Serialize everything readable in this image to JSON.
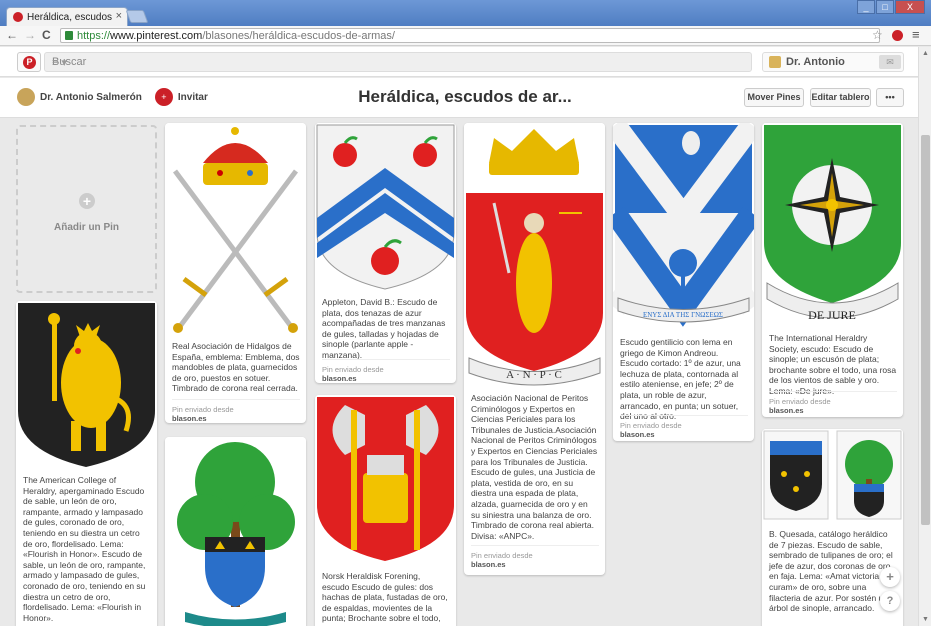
{
  "browser": {
    "tab_title": "Heráldica, escudos de",
    "tab_close": "×",
    "url_scheme": "https://",
    "url_domain": "www.pinterest.com",
    "url_path": "/blasones/heráldica-escudos-de-armas/",
    "back": "←",
    "forward": "→",
    "reload": "C",
    "star": "☆",
    "menu": "≡",
    "window_minimize": "_",
    "window_maximize": "□",
    "window_close": "X"
  },
  "pinterest_bar": {
    "logo": "P",
    "search_placeholder": "Buscar",
    "search_menu": "≡ ▾",
    "user_name": "Dr. Antonio",
    "messages": "✉"
  },
  "board_header": {
    "owner": "Dr. Antonio Salmerón",
    "invite_icon": "+",
    "invite": "Invitar",
    "title": "Heráldica, escudos de ar...",
    "move_pins": "Mover Pines",
    "edit_board": "Editar tablero",
    "more": "•••"
  },
  "add_pin": {
    "plus": "+",
    "label": "Añadir un Pin"
  },
  "pins": [
    {
      "desc": "The American College of Heraldry, apergaminado Escudo de sable, un león de oro, rampante, armado y lampasado de gules, coronado de oro, teniendo en su diestra un cetro de oro, flordelisado. Lema: «Flourish in Honor». Escudo de sable, un león de oro, rampante, armado y lampasado de gules, coronado de oro, teniendo en su diestra un cetro de oro, flordelisado. Lema: «Flourish in Honor»."
    },
    {
      "desc": "Real Asociación de Hidalgos de España, emblema: Emblema, dos mandobles de plata, guarnecidos de oro, puestos en sotuer. Timbrado de corona real cerrada.",
      "via": "Pin enviado desde",
      "source": "blason.es"
    },
    {
      "desc": "Appleton, David B.: Escudo de plata, dos tenazas de azur acompañadas de tres manzanas de gules, talladas y hojadas de sinople (parlante apple - manzana).",
      "via": "Pin enviado desde",
      "source": "blason.es"
    },
    {
      "desc": "Norsk Heraldisk Forening, escudo Escudo de gules: dos hachas de plata, fustadas de oro, de espaldas, movientes de la punta; Brochante sobre el todo, en el"
    },
    {
      "desc": "Asociación Nacional de Peritos Criminólogos y Expertos en Ciencias Periciales para los Tribunales de Justicia.Asociación Nacional de Peritos Criminólogos y Expertos en Ciencias Periciales para los Tribunales de Justicia. Escudo de gules, una Justicia de plata, vestida de oro, en su diestra una espada de plata, alzada, guarnecida de oro y en su siniestra una balanza de oro. Timbrado de corona real abierta. Divisa: «ANPC».",
      "via": "Pin enviado desde",
      "source": "blason.es",
      "scroll": "A · N · P · C"
    },
    {
      "desc": "Escudo gentilicio con lema en griego de Kimon Andreou. Escudo cortado: 1º de azur, una lechuza de plata, contornada al estilo ateniense, en jefe; 2º de plata, un roble de azur, arrancado, en punta; un sotuer, del uno al otro.",
      "via": "Pin enviado desde",
      "source": "blason.es",
      "scroll": "ΕΝΥΣ ΔΙΑ ΤΗΣ ΓΝΩΣΕΩΣ"
    },
    {
      "desc": "The International Heraldry Society, escudo: Escudo de sinople; un escusón de plata; brochante sobre el todo, una rosa de los vientos de sable y oro. Lema: «De jure».",
      "via": "Pin enviado desde",
      "source": "blason.es",
      "scroll": "DE JURE"
    },
    {
      "desc": "B. Quesada, catálogo heráldico de 7 piezas. Escudo de sable, sembrado de tulipanes de oro; el jefe de azur, dos coronas de oro, en faja. Lema: «Amat victoria curam» de oro, sobre una filacteria de azur. Por sostén un árbol de sinople, arrancado."
    }
  ],
  "fab": {
    "plus": "+",
    "help": "?"
  },
  "scrollbar": {
    "up": "▲",
    "down": "▼"
  },
  "colors": {
    "pinterest_red": "#cb2027",
    "gules": "#e02020",
    "azur": "#2a6fc9",
    "sinople": "#2fa33a",
    "or": "#f2c200",
    "sable": "#222222"
  }
}
